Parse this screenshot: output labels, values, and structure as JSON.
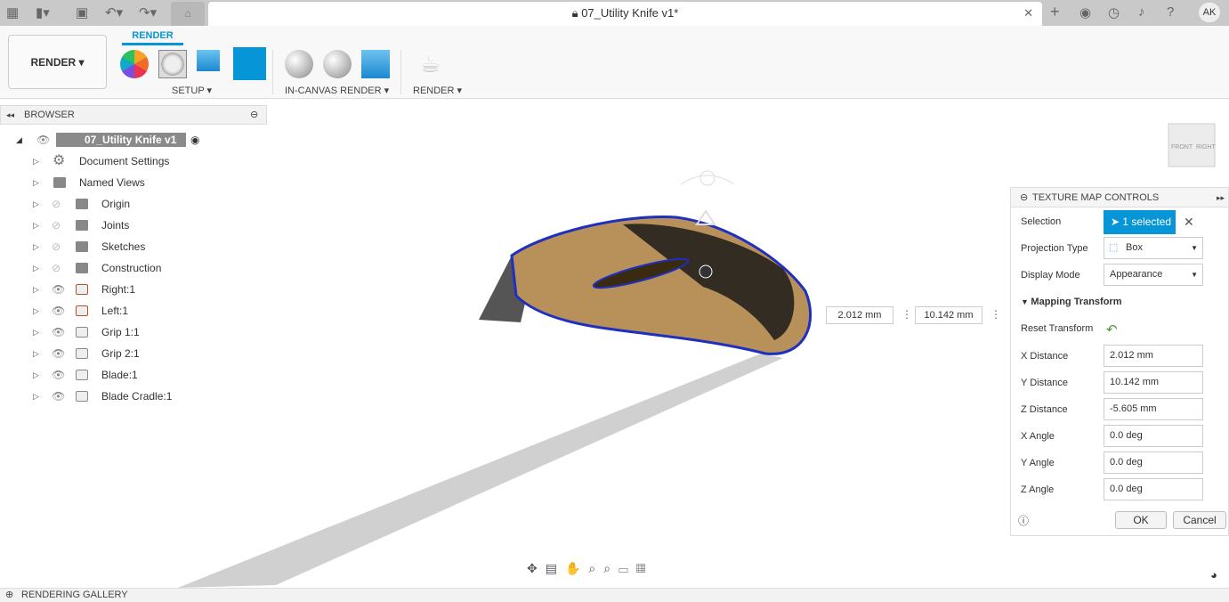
{
  "titlebar": {
    "document_title": "07_Utility Knife v1*",
    "user_initials": "AK"
  },
  "ribbon": {
    "workspace": "RENDER ▾",
    "active_tab": "RENDER",
    "groups": [
      "SETUP ▾",
      "IN-CANVAS RENDER ▾",
      "RENDER ▾"
    ]
  },
  "browser": {
    "title": "BROWSER",
    "root": "07_Utility Knife v1",
    "items": [
      {
        "label": "Document Settings",
        "icon": "gear"
      },
      {
        "label": "Named Views",
        "icon": "folder"
      },
      {
        "label": "Origin",
        "icon": "folder",
        "hidden": true
      },
      {
        "label": "Joints",
        "icon": "folder",
        "hidden": true
      },
      {
        "label": "Sketches",
        "icon": "folder",
        "hidden": true
      },
      {
        "label": "Construction",
        "icon": "folder",
        "hidden": true
      },
      {
        "label": "Right:1",
        "icon": "component"
      },
      {
        "label": "Left:1",
        "icon": "component"
      },
      {
        "label": "Grip 1:1",
        "icon": "body"
      },
      {
        "label": "Grip 2:1",
        "icon": "body"
      },
      {
        "label": "Blade:1",
        "icon": "body"
      },
      {
        "label": "Blade Cradle:1",
        "icon": "body"
      }
    ]
  },
  "canvas": {
    "dim_x": "2.012 mm",
    "dim_y": "10.142 mm",
    "viewcube_front": "FRONT",
    "viewcube_right": "RIGHT"
  },
  "panel": {
    "title": "TEXTURE MAP CONTROLS",
    "selection_label": "Selection",
    "selection_value": "1 selected",
    "projection_label": "Projection Type",
    "projection_value": "Box",
    "display_label": "Display Mode",
    "display_value": "Appearance",
    "section": "Mapping Transform",
    "reset": "Reset Transform",
    "fields": [
      {
        "label": "X Distance",
        "value": "2.012 mm"
      },
      {
        "label": "Y Distance",
        "value": "10.142 mm"
      },
      {
        "label": "Z Distance",
        "value": "-5.605 mm"
      },
      {
        "label": "X Angle",
        "value": "0.0 deg"
      },
      {
        "label": "Y Angle",
        "value": "0.0 deg"
      },
      {
        "label": "Z Angle",
        "value": "0.0 deg"
      }
    ],
    "ok": "OK",
    "cancel": "Cancel"
  },
  "bottom": {
    "label": "RENDERING GALLERY"
  },
  "colors": {
    "accent": "#0696d7",
    "selection_outline": "#1f2fbf",
    "texture": "#b8915a"
  }
}
